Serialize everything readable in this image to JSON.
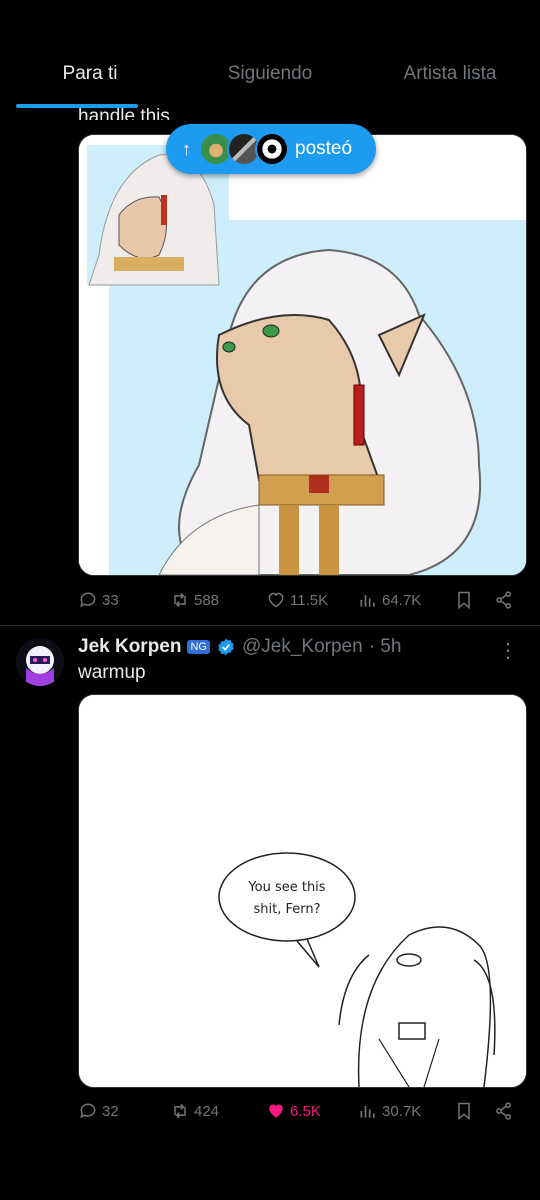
{
  "tabs": [
    {
      "label": "Para ti",
      "active": true
    },
    {
      "label": "Siguiendo",
      "active": false
    },
    {
      "label": "Artista lista",
      "active": false
    }
  ],
  "post1": {
    "partial_text": "handle this.",
    "repost_pill": {
      "arrow": "↑",
      "label": "posteó"
    },
    "stats": {
      "replies": "33",
      "reposts": "588",
      "likes": "11.5K",
      "views": "64.7K"
    }
  },
  "post2": {
    "display_name": "Jek Korpen",
    "badge": "NG",
    "handle": "@Jek_Korpen",
    "time": "· 5h",
    "more": "⋮",
    "text": "warmup",
    "image_text": [
      "You see this",
      "shit, Fern?"
    ],
    "stats": {
      "replies": "32",
      "reposts": "424",
      "likes": "6.5K",
      "views": "30.7K"
    },
    "liked": true
  },
  "colors": {
    "accent": "#1d9bf0",
    "like": "#f91880",
    "muted": "#71767b",
    "bg": "#000000"
  }
}
